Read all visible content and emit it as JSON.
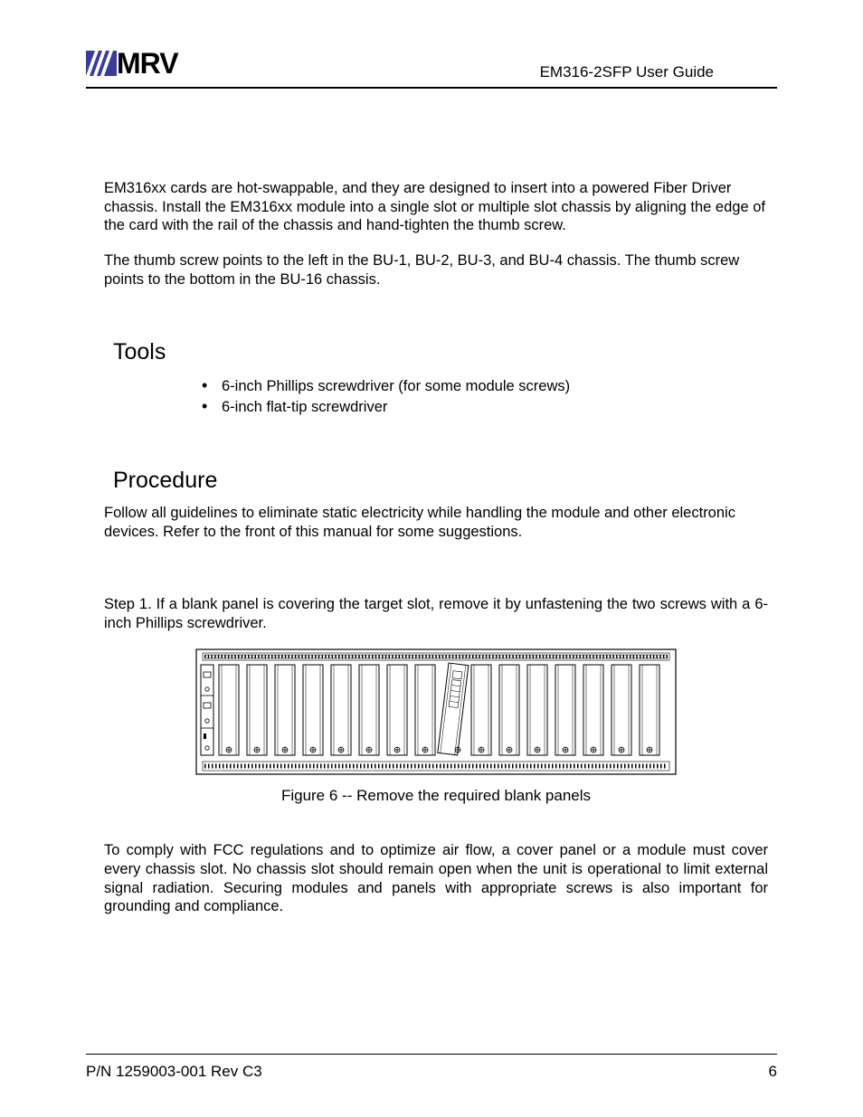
{
  "header": {
    "brand": "MRV",
    "doc_title": "EM316-2SFP User Guide"
  },
  "intro": {
    "p1": "EM316xx cards are hot-swappable, and they are designed to insert into a powered Fiber Driver chassis. Install the EM316xx module into a single slot or multiple slot chassis by aligning the edge of the card with the rail of the chassis and hand-tighten the thumb screw.",
    "p2": "The thumb screw points to the left in the BU-1, BU-2, BU-3, and BU-4 chassis. The thumb screw points to the bottom in the BU-16 chassis."
  },
  "tools": {
    "heading": "Tools",
    "items": [
      "6-inch Phillips screwdriver (for some module screws)",
      "6-inch flat-tip screwdriver"
    ]
  },
  "procedure": {
    "heading": "Procedure",
    "intro": "Follow all guidelines to eliminate static electricity while handling the module and other electronic devices. Refer to the front of this manual for some suggestions.",
    "step1": "Step 1. If a blank panel is covering the target slot, remove it by unfastening the two screws with a 6-inch Phillips screwdriver.",
    "figure_caption": "Figure 6   -- Remove the required blank panels",
    "compliance": "To comply with FCC regulations and to optimize air flow, a cover panel or a module must cover every chassis slot. No chassis slot should remain open when the unit is operational to limit external signal radiation. Securing modules and panels with appropriate screws is also important for grounding and compliance."
  },
  "footer": {
    "pn": "P/N 1259003-001 Rev C3",
    "page": "6"
  }
}
